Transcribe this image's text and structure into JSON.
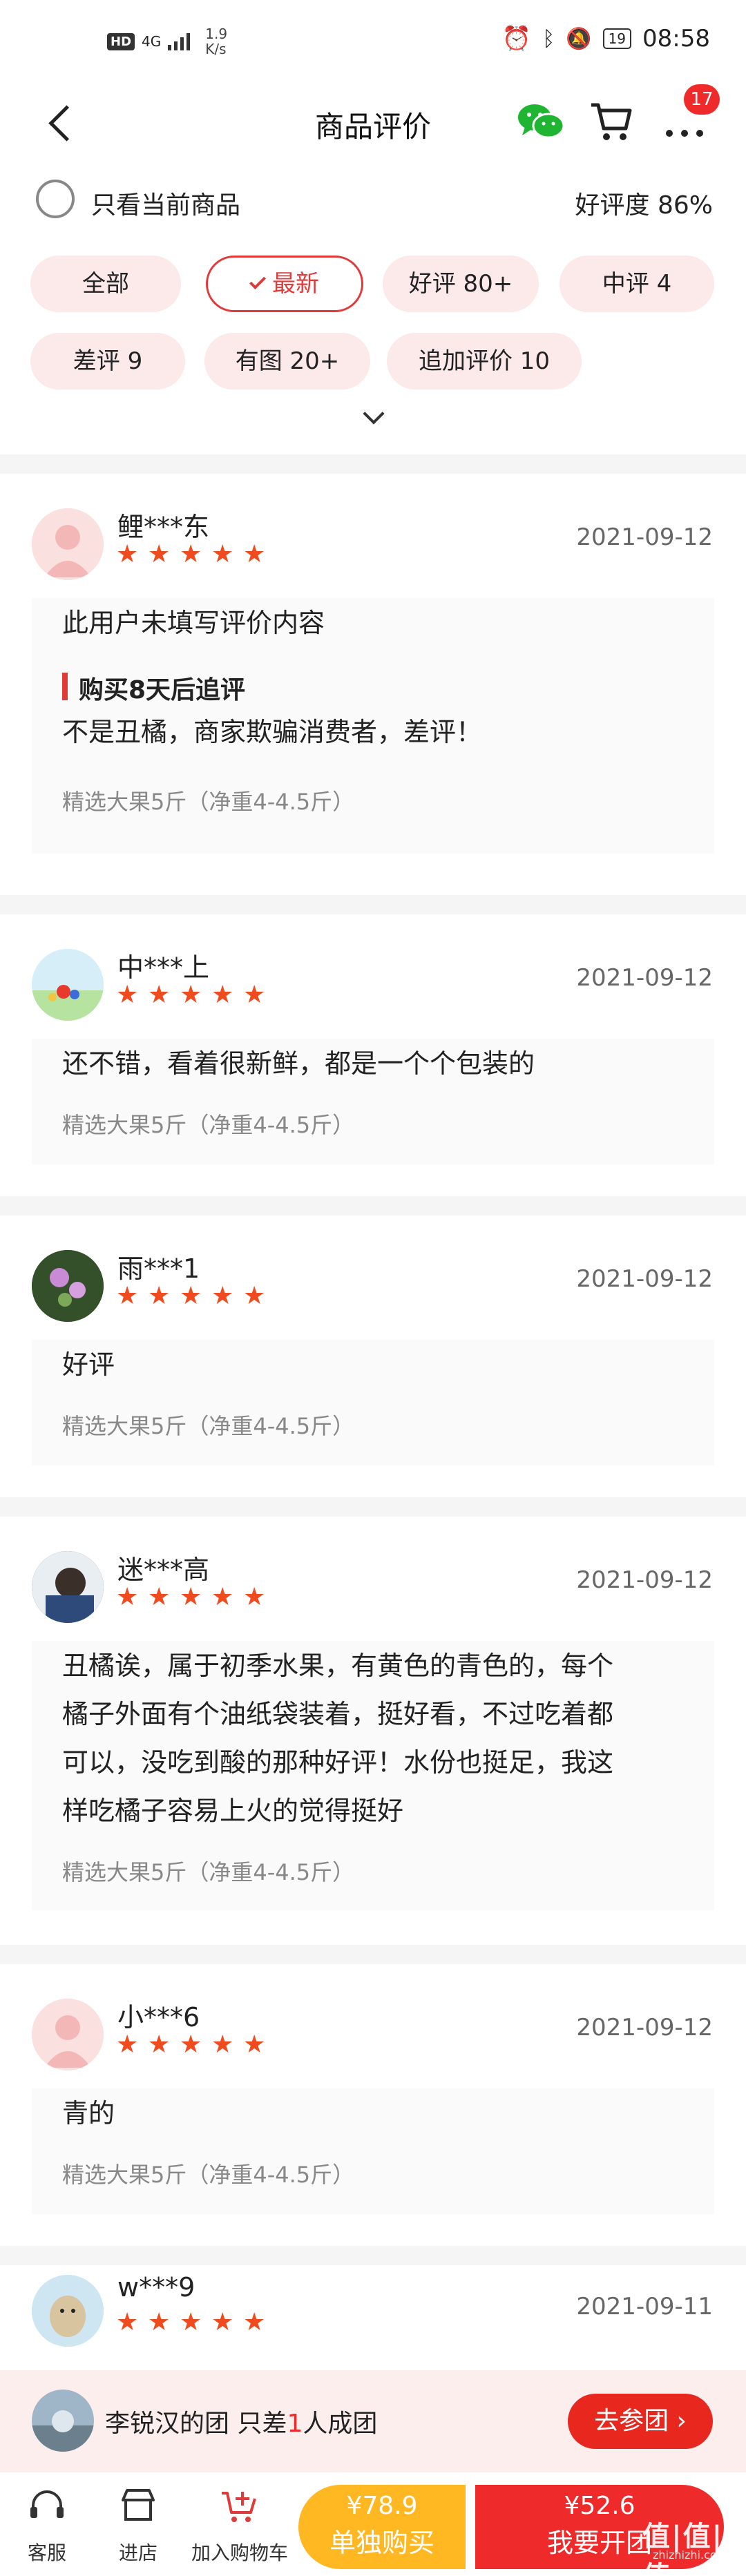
{
  "status_bar": {
    "hd": "HD",
    "network": "4G",
    "speed_value": "1.9",
    "speed_unit": "K/s",
    "battery": "19",
    "time": "08:58"
  },
  "header": {
    "title": "商品评价",
    "cart_badge": "17",
    "icons": [
      "back-icon",
      "wechat-icon",
      "cart-icon",
      "more-icon"
    ]
  },
  "filter": {
    "only_current_label": "只看当前商品",
    "good_rate": "好评度 86%"
  },
  "tags": [
    {
      "label": "全部"
    },
    {
      "label": "最新",
      "active": true
    },
    {
      "label": "好评 80+"
    },
    {
      "label": "中评 4"
    },
    {
      "label": "差评 9"
    },
    {
      "label": "有图 20+"
    },
    {
      "label": "追加评价 10"
    }
  ],
  "reviews": [
    {
      "user": "鲤***东",
      "stars": 5,
      "date": "2021-09-12",
      "text": "此用户未填写评价内容",
      "followup_title": "购买8天后追评",
      "followup_text": "不是丑橘，商家欺骗消费者，差评！",
      "spec": "精选大果5斤（净重4-4.5斤）"
    },
    {
      "user": "中***上",
      "stars": 5,
      "date": "2021-09-12",
      "text": "还不错，看着很新鲜，都是一个个包装的",
      "spec": "精选大果5斤（净重4-4.5斤）"
    },
    {
      "user": "雨***1",
      "stars": 5,
      "date": "2021-09-12",
      "text": "好评",
      "spec": "精选大果5斤（净重4-4.5斤）"
    },
    {
      "user": "迷***高",
      "stars": 5,
      "date": "2021-09-12",
      "text_lines": [
        "丑橘诶，属于初季水果，有黄色的青色的，每个",
        "橘子外面有个油纸袋装着，挺好看，不过吃着都",
        "可以，没吃到酸的那种好评！水份也挺足，我这",
        "样吃橘子容易上火的觉得挺好"
      ],
      "spec": "精选大果5斤（净重4-4.5斤）"
    },
    {
      "user": "小***6",
      "stars": 5,
      "date": "2021-09-12",
      "text": "青的",
      "spec": "精选大果5斤（净重4-4.5斤）"
    },
    {
      "user": "w***9",
      "stars": 5,
      "date": "2021-09-11"
    }
  ],
  "group": {
    "prefix": "李锐汉的团 只差",
    "num": "1",
    "suffix": "人成团",
    "button": "去参团"
  },
  "bottom": {
    "service": "客服",
    "shop": "进店",
    "add_cart": "加入购物车",
    "buy_alone_price": "¥78.9",
    "buy_alone_label": "单独购买",
    "group_price": "¥52.6",
    "group_label": "我要开团"
  },
  "watermark": {
    "text": "值|值|值",
    "sub": "zhizhizhi.com"
  },
  "colors": {
    "accent": "#e03b3b",
    "star": "#f04b1e",
    "tag_bg": "#fce9ea",
    "buy_alone": "#ffb822",
    "buy_group": "#ee2a2a"
  }
}
